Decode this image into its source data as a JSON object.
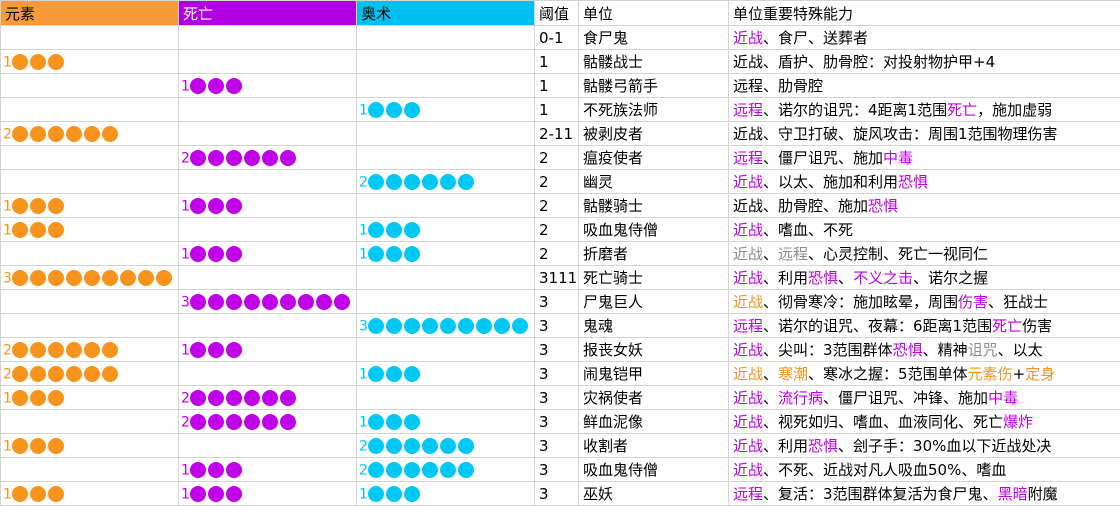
{
  "colors": {
    "element": "#f7941d",
    "death": "#c000e8",
    "arcane": "#00c8f4",
    "grey": "#8c8c8c"
  },
  "header": {
    "element": "元素",
    "death": "死亡",
    "arcane": "奥术",
    "threshold": "阈值",
    "unit": "单位",
    "abilities": "单位重要特殊能力"
  },
  "rows": [
    {
      "e": null,
      "d": null,
      "a": null,
      "threshold": "0-1",
      "unit": "食尸鬼",
      "abilities": [
        {
          "t": "近战",
          "c": "death"
        },
        {
          "t": "、食尸、送葬者"
        }
      ]
    },
    {
      "e": 1,
      "d": null,
      "a": null,
      "threshold": "1",
      "unit": "骷髅战士",
      "abilities": [
        {
          "t": "近战、盾护、肋骨腔：对投射物护甲+4"
        }
      ]
    },
    {
      "e": null,
      "d": 1,
      "a": null,
      "threshold": "1",
      "unit": "骷髅弓箭手",
      "abilities": [
        {
          "t": "远程、肋骨腔"
        }
      ]
    },
    {
      "e": null,
      "d": null,
      "a": 1,
      "threshold": "1",
      "unit": "不死族法师",
      "abilities": [
        {
          "t": "远程",
          "c": "death"
        },
        {
          "t": "、诺尔的诅咒：4距离1范围"
        },
        {
          "t": "死亡",
          "c": "death"
        },
        {
          "t": "，施加虚弱"
        }
      ]
    },
    {
      "e": 2,
      "d": null,
      "a": null,
      "threshold": "2-11",
      "unit": "被剥皮者",
      "abilities": [
        {
          "t": "近战、守卫打破、旋风攻击：周围1范围物理伤害"
        }
      ]
    },
    {
      "e": null,
      "d": 2,
      "a": null,
      "threshold": "2",
      "unit": "瘟疫使者",
      "abilities": [
        {
          "t": "远程",
          "c": "death"
        },
        {
          "t": "、僵尸诅咒、施加"
        },
        {
          "t": "中毒",
          "c": "death"
        }
      ]
    },
    {
      "e": null,
      "d": null,
      "a": 2,
      "threshold": "2",
      "unit": "幽灵",
      "abilities": [
        {
          "t": "近战",
          "c": "death"
        },
        {
          "t": "、以太、施加和利用"
        },
        {
          "t": "恐惧",
          "c": "death"
        }
      ]
    },
    {
      "e": 1,
      "d": 1,
      "a": null,
      "threshold": "2",
      "unit": "骷髅骑士",
      "abilities": [
        {
          "t": "近战、肋骨腔、施加"
        },
        {
          "t": "恐惧",
          "c": "death"
        }
      ]
    },
    {
      "e": 1,
      "d": null,
      "a": 1,
      "threshold": "2",
      "unit": "吸血鬼侍僧",
      "abilities": [
        {
          "t": "近战",
          "c": "death"
        },
        {
          "t": "、嗜血、不死"
        }
      ]
    },
    {
      "e": null,
      "d": 1,
      "a": 1,
      "threshold": "2",
      "unit": "折磨者",
      "abilities": [
        {
          "t": "近战",
          "c": "grey"
        },
        {
          "t": "、"
        },
        {
          "t": "远程",
          "c": "grey"
        },
        {
          "t": "、心灵控制、死亡一视同仁"
        }
      ]
    },
    {
      "e": 3,
      "d": null,
      "a": null,
      "threshold": "3111",
      "unit": "死亡骑士",
      "abilities": [
        {
          "t": "近战",
          "c": "death"
        },
        {
          "t": "、利用"
        },
        {
          "t": "恐惧",
          "c": "death"
        },
        {
          "t": "、"
        },
        {
          "t": "不义之击",
          "c": "death"
        },
        {
          "t": "、诺尔之握"
        }
      ]
    },
    {
      "e": null,
      "d": 3,
      "a": null,
      "threshold": "3",
      "unit": "尸鬼巨人",
      "abilities": [
        {
          "t": "近战",
          "c": "element"
        },
        {
          "t": "、彻骨寒冷：施加眩晕，周围"
        },
        {
          "t": "伤害",
          "c": "death"
        },
        {
          "t": "、狂战士"
        }
      ]
    },
    {
      "e": null,
      "d": null,
      "a": 3,
      "threshold": "3",
      "unit": "鬼魂",
      "abilities": [
        {
          "t": "远程",
          "c": "death"
        },
        {
          "t": "、诺尔的诅咒、夜幕：6距离1范围"
        },
        {
          "t": "死亡",
          "c": "death"
        },
        {
          "t": "伤害"
        }
      ]
    },
    {
      "e": 2,
      "d": 1,
      "a": null,
      "threshold": "3",
      "unit": "报丧女妖",
      "abilities": [
        {
          "t": "近战",
          "c": "death"
        },
        {
          "t": "、尖叫：3范围群体"
        },
        {
          "t": "恐惧",
          "c": "death"
        },
        {
          "t": "、精神"
        },
        {
          "t": "诅咒",
          "c": "grey"
        },
        {
          "t": "、以太"
        }
      ]
    },
    {
      "e": 2,
      "d": null,
      "a": 1,
      "threshold": "3",
      "unit": "闹鬼铠甲",
      "abilities": [
        {
          "t": "近战",
          "c": "element"
        },
        {
          "t": "、"
        },
        {
          "t": "寒潮",
          "c": "element"
        },
        {
          "t": "、寒冰之握：5范围单体"
        },
        {
          "t": "元素伤",
          "c": "element"
        },
        {
          "t": "+"
        },
        {
          "t": "定身",
          "c": "element"
        }
      ]
    },
    {
      "e": 1,
      "d": 2,
      "a": null,
      "threshold": "3",
      "unit": "灾祸使者",
      "abilities": [
        {
          "t": "近战",
          "c": "death"
        },
        {
          "t": "、"
        },
        {
          "t": "流行病",
          "c": "death"
        },
        {
          "t": "、僵尸诅咒、冲锋、施加"
        },
        {
          "t": "中毒",
          "c": "death"
        }
      ]
    },
    {
      "e": null,
      "d": 2,
      "a": 1,
      "threshold": "3",
      "unit": "鲜血泥像",
      "abilities": [
        {
          "t": "近战",
          "c": "death"
        },
        {
          "t": "、视死如归、嗜血、血液同化、死亡"
        },
        {
          "t": "爆炸",
          "c": "death"
        }
      ]
    },
    {
      "e": 1,
      "d": null,
      "a": 2,
      "threshold": "3",
      "unit": "收割者",
      "abilities": [
        {
          "t": "近战",
          "c": "death"
        },
        {
          "t": "、利用"
        },
        {
          "t": "恐惧",
          "c": "death"
        },
        {
          "t": "、刽子手：30%血以下近战处决"
        }
      ]
    },
    {
      "e": null,
      "d": 1,
      "a": 2,
      "threshold": "3",
      "unit": "吸血鬼侍僧",
      "abilities": [
        {
          "t": "近战",
          "c": "death"
        },
        {
          "t": "、不死、近战对凡人吸血50%、嗜血"
        }
      ]
    },
    {
      "e": 1,
      "d": 1,
      "a": 1,
      "threshold": "3",
      "unit": "巫妖",
      "abilities": [
        {
          "t": "远程",
          "c": "death"
        },
        {
          "t": "、复活：3范围群体复活为食尸鬼、"
        },
        {
          "t": "黑暗",
          "c": "death"
        },
        {
          "t": "附魔"
        }
      ]
    }
  ]
}
